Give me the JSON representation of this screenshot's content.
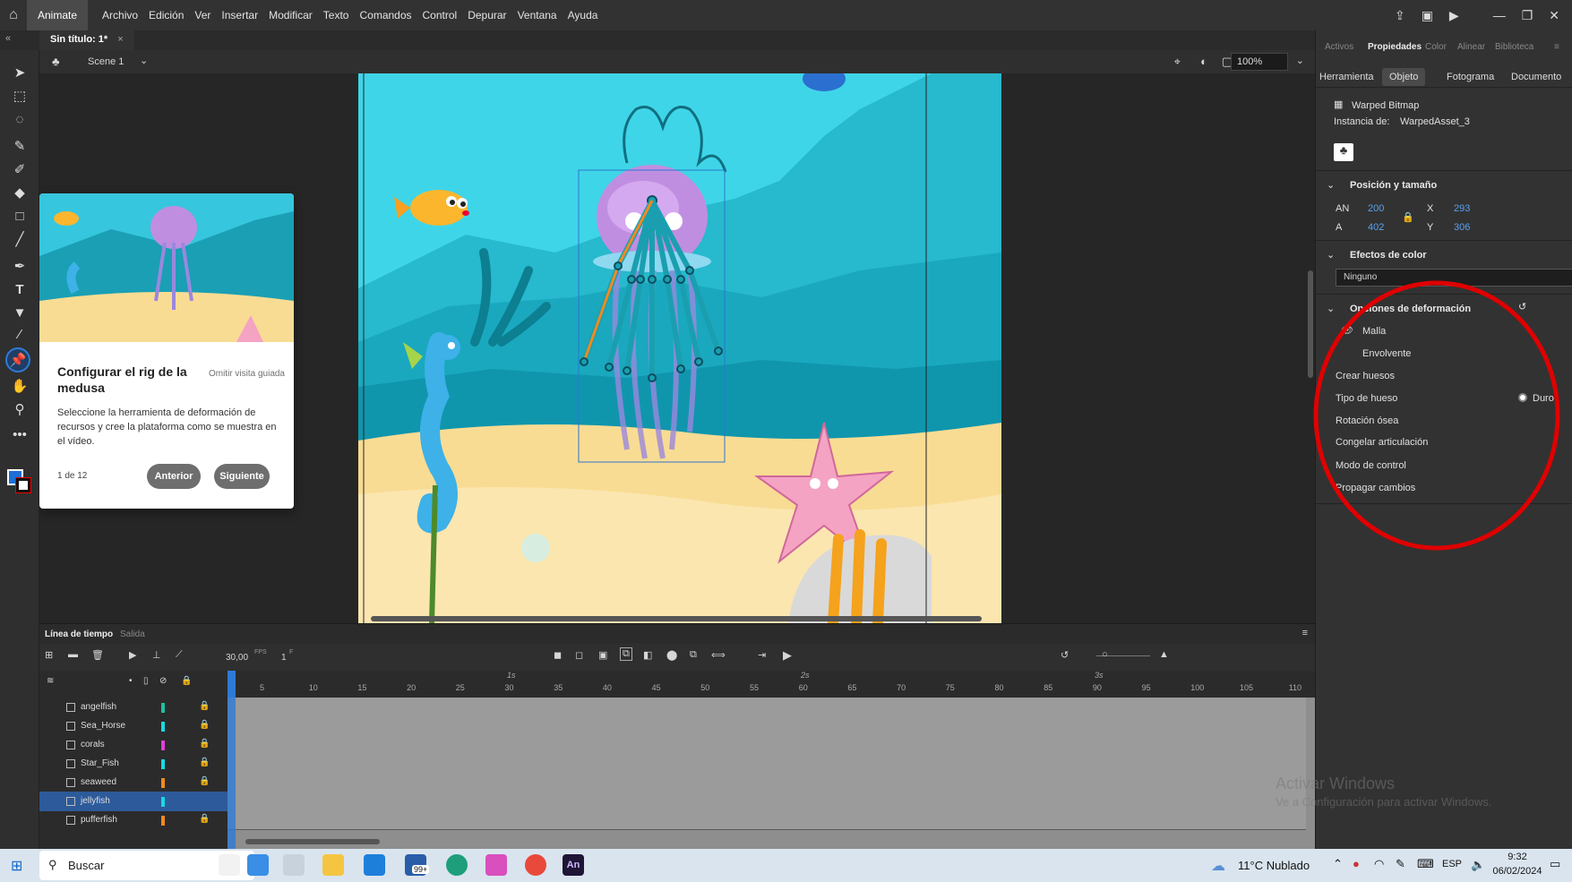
{
  "menubar": {
    "app": "Animate",
    "menus": [
      "Archivo",
      "Edición",
      "Ver",
      "Insertar",
      "Modificar",
      "Texto",
      "Comandos",
      "Control",
      "Depurar",
      "Ventana",
      "Ayuda"
    ]
  },
  "document": {
    "tab": "Sin título: 1*",
    "scene": "Scene 1",
    "zoom": "100%"
  },
  "tour": {
    "title": "Configurar el rig de la medusa",
    "skip": "Omitir visita guiada",
    "description": "Seleccione la herramienta de deformación de recursos y cree la plataforma como se muestra en el vídeo.",
    "count": "1 de 12",
    "prev": "Anterior",
    "next": "Siguiente"
  },
  "props": {
    "top_tabs": [
      "Activos",
      "Propiedades",
      "Color",
      "Alinear",
      "Biblioteca"
    ],
    "sub_tabs": [
      "Herramienta",
      "Objeto",
      "Fotograma",
      "Documento"
    ],
    "object_type": "Warped Bitmap",
    "instance_label": "Instancia de:",
    "instance_value": "WarpedAsset_3",
    "pos_section": "Posición y tamaño",
    "w_label": "AN",
    "w_value": "200",
    "h_label": "A",
    "h_value": "402",
    "x_label": "X",
    "x_value": "293",
    "y_label": "Y",
    "y_value": "306",
    "color_section": "Efectos de color",
    "color_value": "Ninguno",
    "warp_section": "Opciones de deformación",
    "mesh": "Malla",
    "envelope": "Envolvente",
    "create_bones": "Crear huesos",
    "bone_type": "Tipo de hueso",
    "bone_type_value": "Duro",
    "bone_rotation": "Rotación ósea",
    "freeze_joint": "Congelar articulación",
    "control_mode": "Modo de control",
    "propagate": "Propagar cambios",
    "annotation_color": "#e00000"
  },
  "timeline": {
    "tabs": [
      "Línea de tiempo",
      "Salida"
    ],
    "fps": "30,00",
    "fps_unit": "FPS",
    "frame": "1",
    "frame_unit": "F",
    "seconds": [
      "1s",
      "2s",
      "3s"
    ],
    "ticks": [
      "5",
      "10",
      "15",
      "20",
      "25",
      "30",
      "35",
      "40",
      "45",
      "50",
      "55",
      "60",
      "65",
      "70",
      "75",
      "80",
      "85",
      "90",
      "95",
      "100",
      "105",
      "110"
    ],
    "layers": [
      {
        "name": "angelfish",
        "color": "#1fbfa0"
      },
      {
        "name": "Sea_Horse",
        "color": "#19d9e0"
      },
      {
        "name": "corals",
        "color": "#e03fd6"
      },
      {
        "name": "Star_Fish",
        "color": "#19d9e0"
      },
      {
        "name": "seaweed",
        "color": "#f0891c"
      },
      {
        "name": "jellyfish",
        "color": "#19d9e0"
      },
      {
        "name": "pufferfish",
        "color": "#f0891c"
      }
    ],
    "selected_layer": "jellyfish"
  },
  "watermark": {
    "line1": "Activar Windows",
    "line2": "Ve a Configuración para activar Windows."
  },
  "taskbar": {
    "search": "Buscar",
    "badge": "99+",
    "weather": "11°C  Nublado",
    "lang": "ESP",
    "time": "9:32",
    "date": "06/02/2024"
  }
}
